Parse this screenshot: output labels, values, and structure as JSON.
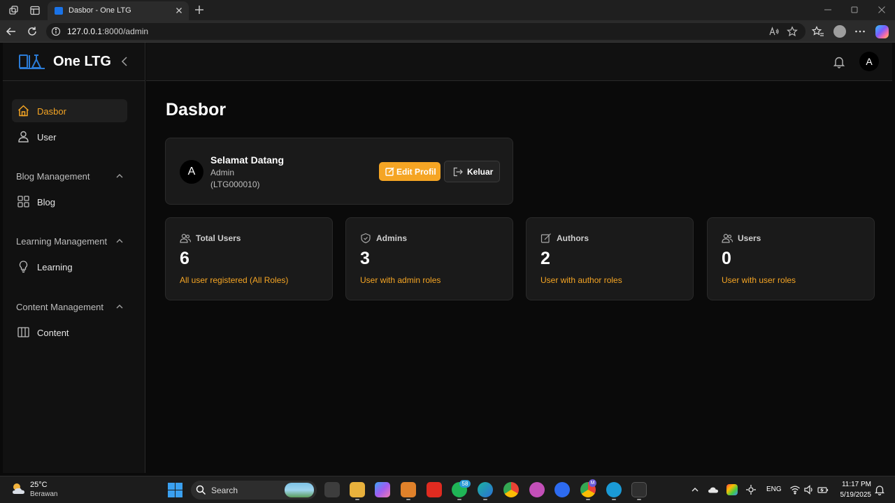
{
  "browser": {
    "tab_title": "Dasbor - One LTG",
    "url_host": "127.0.0.1",
    "url_rest": ":8000/admin"
  },
  "app": {
    "brand": "One LTG",
    "avatar_initial": "A"
  },
  "sidebar": {
    "items": [
      {
        "label": "Dasbor",
        "icon": "home-icon",
        "active": true
      },
      {
        "label": "User",
        "icon": "user-icon",
        "active": false
      }
    ],
    "sections": [
      {
        "title": "Blog Management",
        "items": [
          {
            "label": "Blog",
            "icon": "grid-icon"
          }
        ]
      },
      {
        "title": "Learning Management",
        "items": [
          {
            "label": "Learning",
            "icon": "lightbulb-icon"
          }
        ]
      },
      {
        "title": "Content Management",
        "items": [
          {
            "label": "Content",
            "icon": "columns-icon"
          }
        ]
      }
    ]
  },
  "main": {
    "title": "Dasbor",
    "welcome": {
      "avatar_initial": "A",
      "title": "Selamat Datang",
      "role": "Admin",
      "id": "(LTG000010)",
      "edit_label": "Edit Profil",
      "logout_label": "Keluar"
    },
    "stats": [
      {
        "label": "Total Users",
        "value": "6",
        "desc": "All user registered (All Roles)",
        "icon": "users-icon"
      },
      {
        "label": "Admins",
        "value": "3",
        "desc": "User with admin roles",
        "icon": "shield-icon"
      },
      {
        "label": "Authors",
        "value": "2",
        "desc": "User with author roles",
        "icon": "edit-icon"
      },
      {
        "label": "Users",
        "value": "0",
        "desc": "User with user roles",
        "icon": "users-icon"
      }
    ]
  },
  "taskbar": {
    "temperature": "25°C",
    "weather": "Berawan",
    "search_label": "Search",
    "whatsapp_badge": "58",
    "chrome_badge": "M",
    "language": "ENG",
    "time": "11:17 PM",
    "date": "5/19/2025"
  },
  "colors": {
    "accent": "#f5a524",
    "background": "#0a0a0a",
    "panel": "#1a1a1a"
  }
}
